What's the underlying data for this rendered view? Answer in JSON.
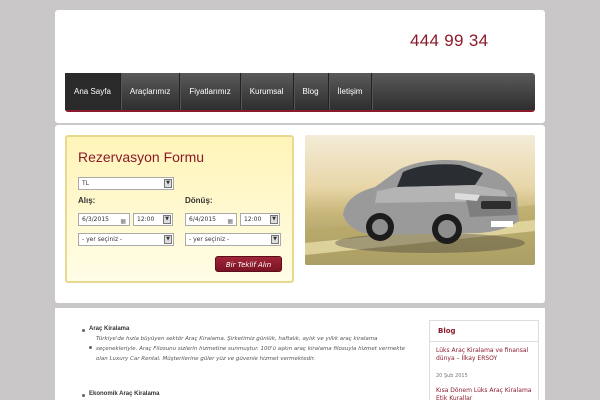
{
  "header": {
    "phone": "444 99 34"
  },
  "nav": {
    "items": [
      "Ana Sayfa",
      "Araçlarımız",
      "Fiyatlarımız",
      "Kurumsal",
      "Blog",
      "İletişim"
    ]
  },
  "form": {
    "title": "Rezervasyon Formu",
    "currency": "TL",
    "pickup_label": "Alış:",
    "return_label": "Dönüş:",
    "pickup_date": "6/3/2015",
    "return_date": "6/4/2015",
    "pickup_time": "12:00",
    "return_time": "12:00",
    "pickup_place": "- yer seçiniz -",
    "return_place": "- yer seçiniz -",
    "submit": "Bir Teklif Alın"
  },
  "content": {
    "section1_title": "Araç Kiralama",
    "section1_text": "Türkiye'de hızla büyüyen sektör Araç Kiralama. Şirketimiz günlük, haftalık, aylık ve yıllık araç kiralama seçenekleriyle. Araç Filosunu sizlerin hizmetine sunmuştur. 100'ü aşkın araç kiralama filosuyla hizmet vermekte olan Luxury Car Rental. Müşterilerine güler yüz ve güvenle hizmet vermektedir.",
    "section2_title": "Ekonomik Araç Kiralama"
  },
  "blog": {
    "title": "Blog",
    "post1_title": "Lüks Araç Kiralama ve finansal dünya – İlkay ERSOY",
    "post1_date": "20 Şub 2015",
    "post2_title": "Kısa Dönem Lüks Araç Kiralama Etik Kurallar"
  },
  "colors": {
    "accent": "#8b1a2b",
    "nav": "#3a3a3a",
    "form_bg": "#fff4b8"
  }
}
